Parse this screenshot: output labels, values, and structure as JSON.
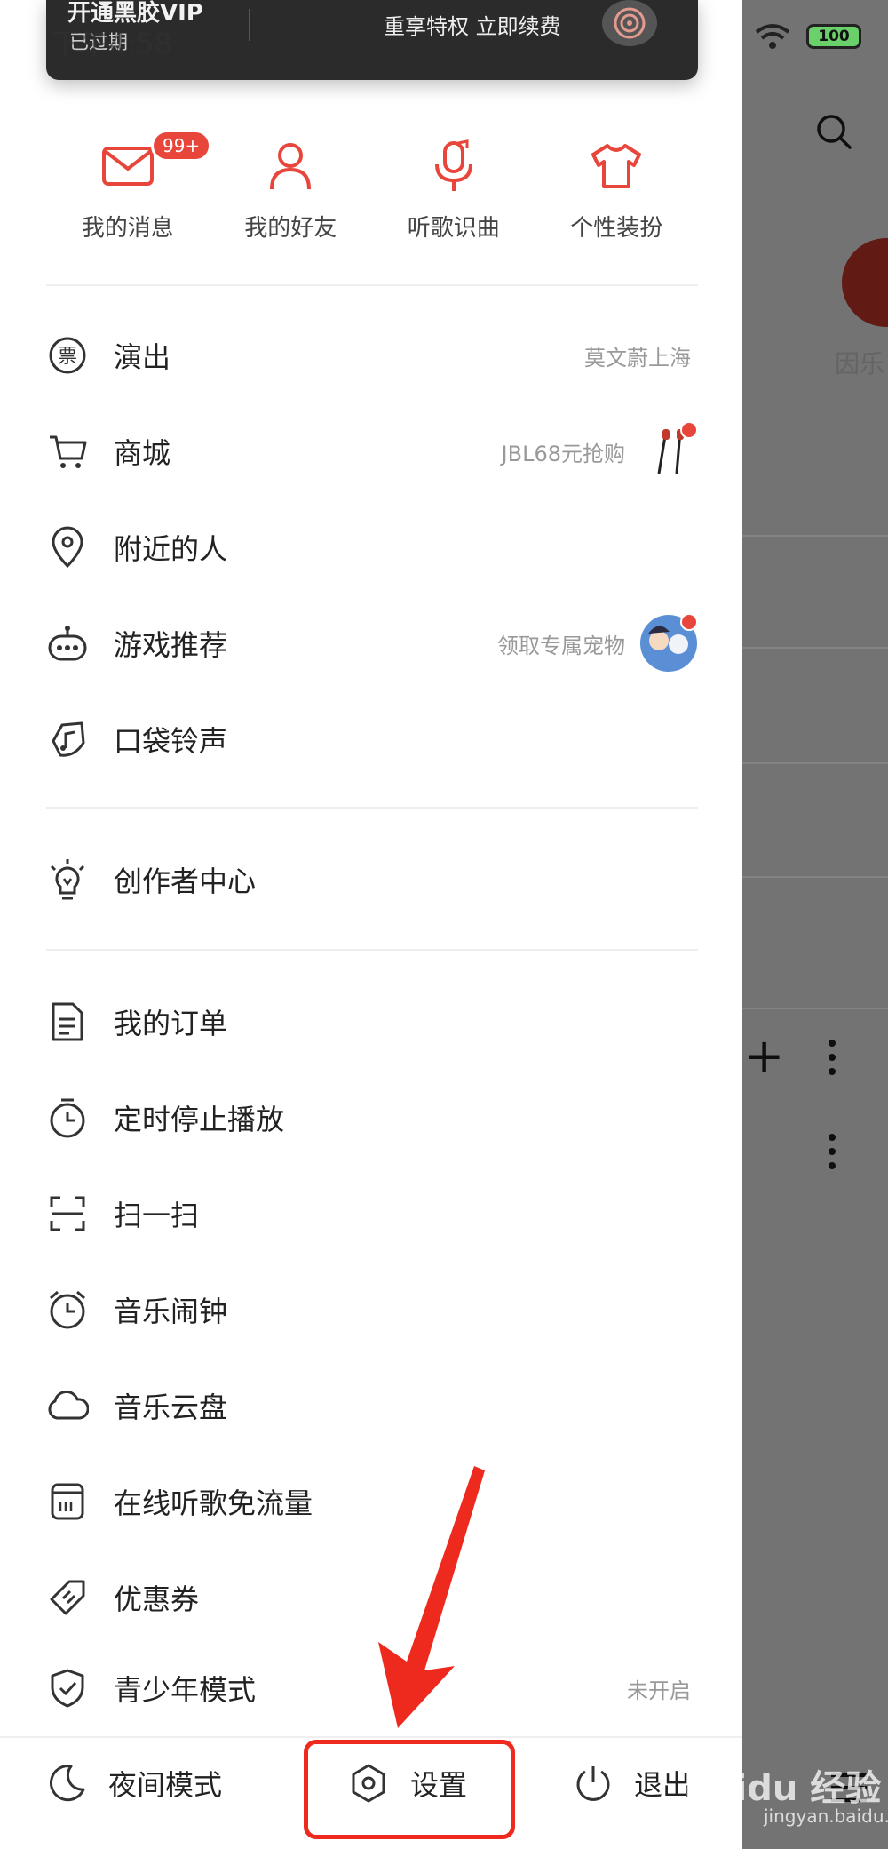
{
  "status": {
    "battery": "100"
  },
  "vip": {
    "title": "开通黑胶VIP",
    "status": "已过期",
    "promo": "重享特权 立即续费"
  },
  "time_overlay": "下午4:58",
  "quick_actions": [
    {
      "label": "我的消息",
      "icon": "mail-icon",
      "badge": "99+"
    },
    {
      "label": "我的好友",
      "icon": "person-icon"
    },
    {
      "label": "听歌识曲",
      "icon": "mic-music-icon"
    },
    {
      "label": "个性装扮",
      "icon": "tshirt-icon"
    }
  ],
  "menu": {
    "group1": [
      {
        "label": "演出",
        "icon": "ticket-icon",
        "hint": "莫文蔚上海"
      },
      {
        "label": "商城",
        "icon": "cart-icon",
        "hint": "JBL68元抢购"
      },
      {
        "label": "附近的人",
        "icon": "location-pin-icon"
      },
      {
        "label": "游戏推荐",
        "icon": "gamepad-icon",
        "hint": "领取专属宠物"
      },
      {
        "label": "口袋铃声",
        "icon": "ringtone-icon"
      }
    ],
    "group2": [
      {
        "label": "创作者中心",
        "icon": "lightbulb-icon"
      }
    ],
    "group3": [
      {
        "label": "我的订单",
        "icon": "order-doc-icon"
      },
      {
        "label": "定时停止播放",
        "icon": "timer-icon"
      },
      {
        "label": "扫一扫",
        "icon": "scan-icon"
      },
      {
        "label": "音乐闹钟",
        "icon": "alarm-clock-icon"
      },
      {
        "label": "音乐云盘",
        "icon": "cloud-icon"
      },
      {
        "label": "在线听歌免流量",
        "icon": "sim-card-icon"
      },
      {
        "label": "优惠券",
        "icon": "coupon-icon"
      },
      {
        "label": "青少年模式",
        "icon": "shield-check-icon",
        "hint": "未开启"
      }
    ]
  },
  "bottom_bar": {
    "night_mode": "夜间模式",
    "settings": "设置",
    "logout": "退出"
  },
  "background": {
    "badge_label": "因乐"
  },
  "watermark": {
    "brand": "Baidu 经验",
    "url": "jingyan.baidu.com"
  },
  "colors": {
    "accent": "#e8453b",
    "annotation": "#ee2a1f"
  }
}
